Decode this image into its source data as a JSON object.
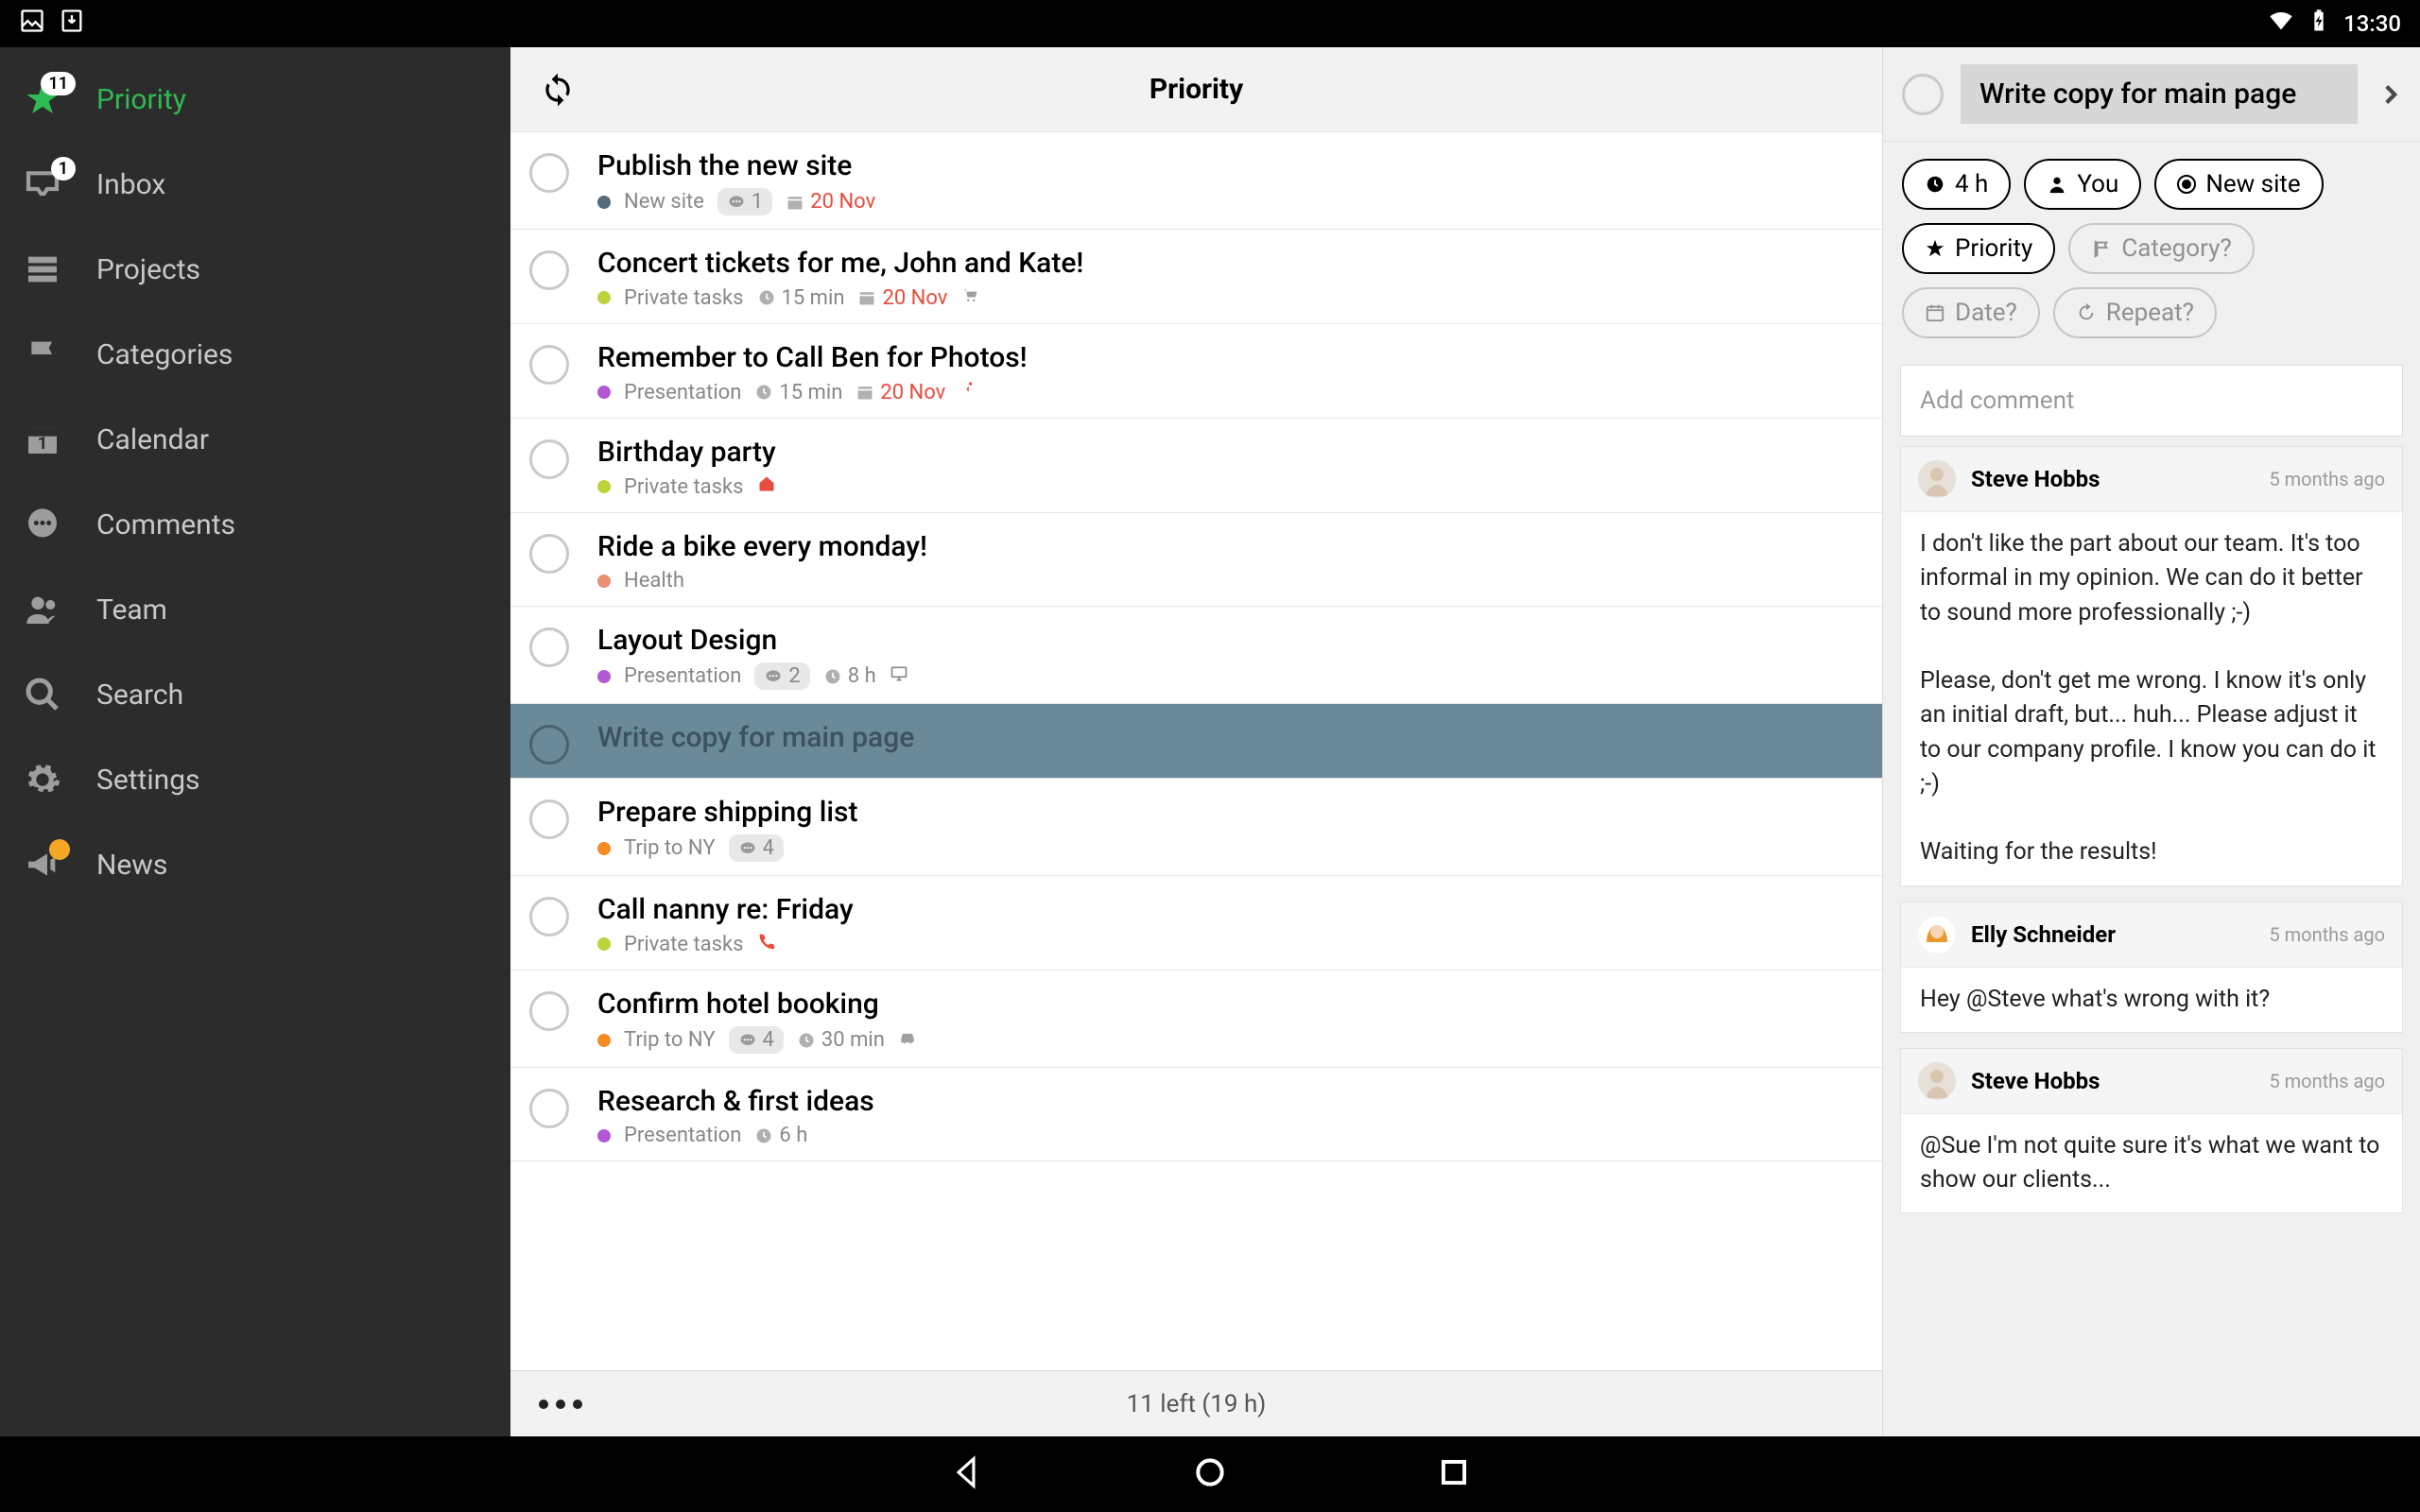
{
  "status_bar": {
    "time": "13:30"
  },
  "sidebar": {
    "items": [
      {
        "label": "Priority",
        "badge": "11",
        "icon": "star",
        "active": true
      },
      {
        "label": "Inbox",
        "badge": "1",
        "icon": "inbox"
      },
      {
        "label": "Projects",
        "icon": "projects"
      },
      {
        "label": "Categories",
        "icon": "flag"
      },
      {
        "label": "Calendar",
        "icon": "calendar"
      },
      {
        "label": "Comments",
        "icon": "comments"
      },
      {
        "label": "Team",
        "icon": "team"
      },
      {
        "label": "Search",
        "icon": "search"
      },
      {
        "label": "Settings",
        "icon": "gear"
      },
      {
        "label": "News",
        "icon": "megaphone",
        "notice": true
      }
    ]
  },
  "main": {
    "title": "Priority",
    "footer": "11 left (19 h)",
    "tasks": [
      {
        "title": "Publish the new site",
        "project": "New site",
        "projClass": "p-newsite",
        "comments": "1",
        "date": "20 Nov"
      },
      {
        "title": "Concert tickets for me, John and Kate!",
        "project": "Private tasks",
        "projClass": "p-private",
        "duration": "15 min",
        "date": "20 Nov",
        "extraIcon": "cart"
      },
      {
        "title": "Remember to Call Ben for Photos!",
        "project": "Presentation",
        "projClass": "p-presentation",
        "duration": "15 min",
        "date": "20 Nov",
        "extraIcon": "run"
      },
      {
        "title": "Birthday party",
        "project": "Private tasks",
        "projClass": "p-private",
        "extraIcon": "home"
      },
      {
        "title": "Ride a bike every monday!",
        "project": "Health",
        "projClass": "p-health"
      },
      {
        "title": "Layout Design",
        "project": "Presentation",
        "projClass": "p-presentation",
        "comments": "2",
        "duration": "8 h",
        "extraIcon": "monitor"
      },
      {
        "title": "Write copy for main page",
        "selected": true
      },
      {
        "title": "Prepare shipping list",
        "project": "Trip to NY",
        "projClass": "p-tripny",
        "comments": "4"
      },
      {
        "title": "Call nanny re: Friday",
        "project": "Private tasks",
        "projClass": "p-private",
        "extraIcon": "phone"
      },
      {
        "title": "Confirm hotel booking",
        "project": "Trip to NY",
        "projClass": "p-tripny",
        "comments": "4",
        "duration": "30 min",
        "extraIcon": "car"
      },
      {
        "title": "Research & first ideas",
        "project": "Presentation",
        "projClass": "p-presentation",
        "duration": "6 h"
      }
    ]
  },
  "detail": {
    "title": "Write copy for main page",
    "chips": {
      "duration": "4 h",
      "assignee": "You",
      "project": "New site",
      "priority": "Priority",
      "category_placeholder": "Category?",
      "date_placeholder": "Date?",
      "repeat_placeholder": "Repeat?"
    },
    "comment_placeholder": "Add comment",
    "comments": [
      {
        "author": "Steve Hobbs",
        "time": "5 months ago",
        "avatar": "male",
        "body": "I don't like the part about our team. It's too informal in my opinion. We can do it better to sound more professionally ;-)\n\nPlease, don't get me wrong. I know it's only an initial draft, but... huh... Please adjust it to our company profile. I know you can do it ;-)\n\nWaiting for the results!"
      },
      {
        "author": "Elly Schneider",
        "time": "5 months ago",
        "avatar": "female",
        "body": "Hey @Steve what's wrong with it?"
      },
      {
        "author": "Steve Hobbs",
        "time": "5 months ago",
        "avatar": "male",
        "body": "@Sue I'm not quite sure it's what we want to show our clients..."
      }
    ]
  }
}
